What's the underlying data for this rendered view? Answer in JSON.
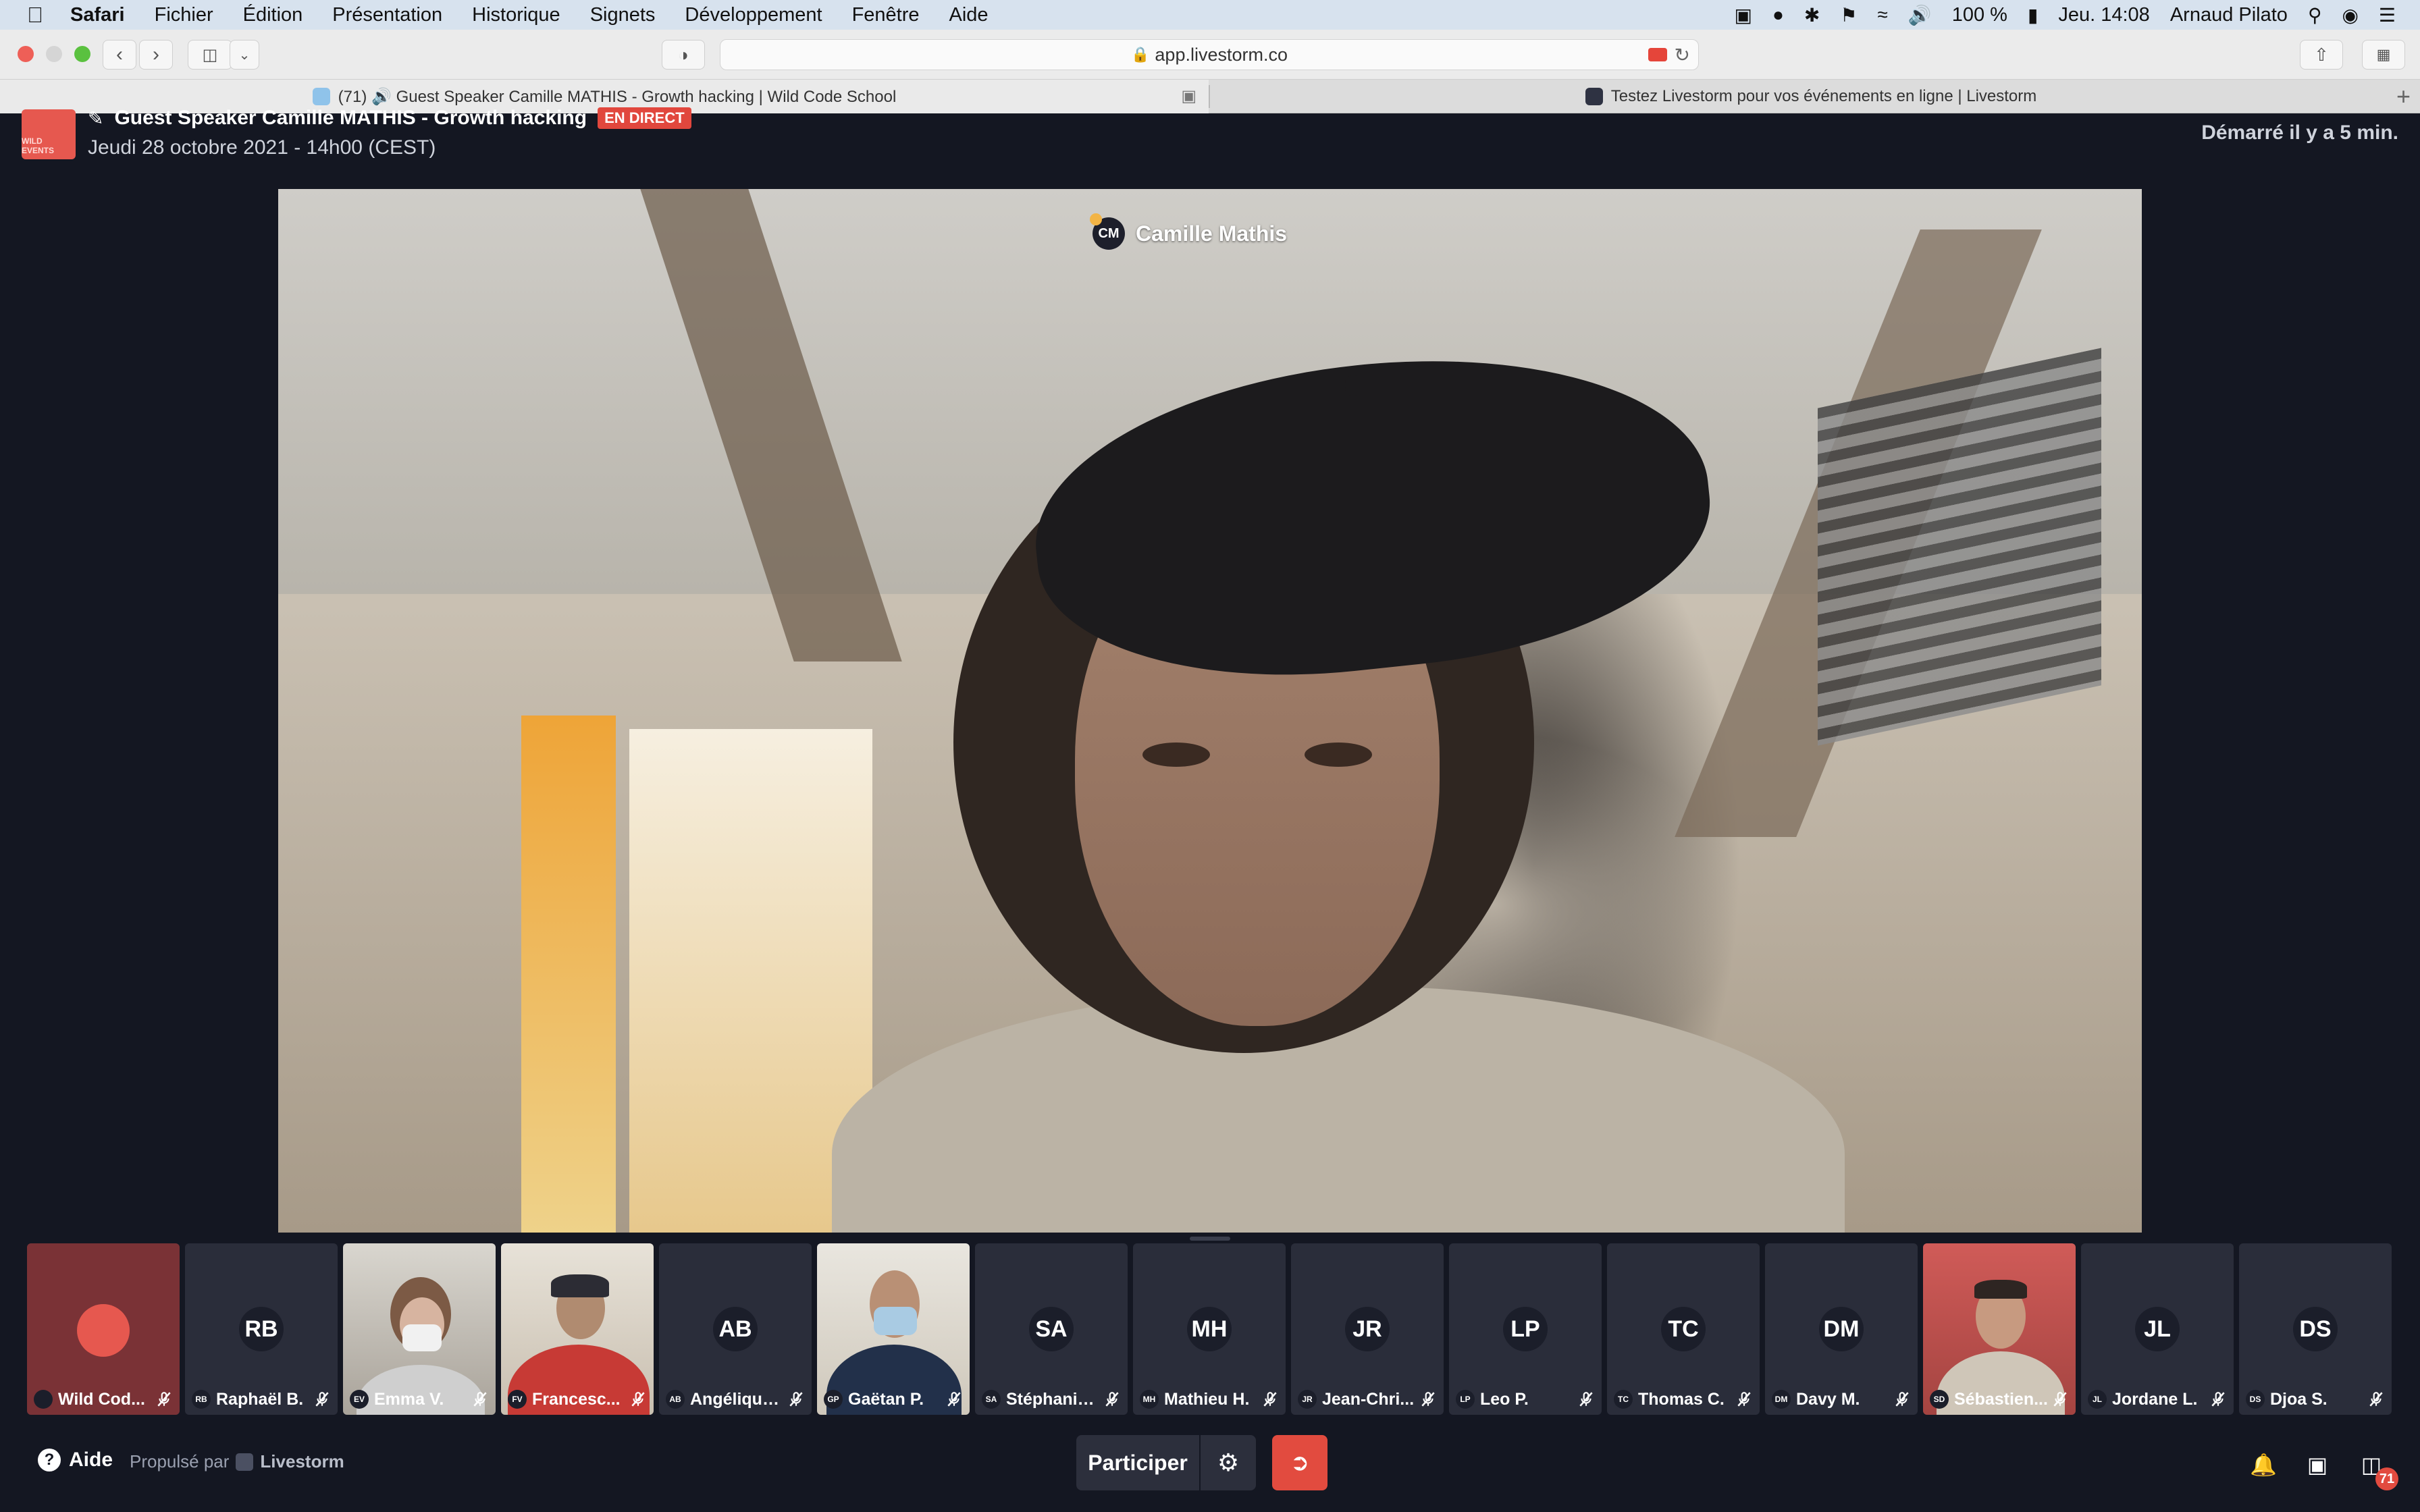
{
  "menubar": {
    "app": "Safari",
    "items": [
      "Fichier",
      "Édition",
      "Présentation",
      "Historique",
      "Signets",
      "Développement",
      "Fenêtre",
      "Aide"
    ],
    "battery": "100 %",
    "clock": "Jeu. 14:08",
    "user": "Arnaud Pilato"
  },
  "browser": {
    "url": "app.livestorm.co",
    "tabs": [
      {
        "label": "(71) 🔊 Guest Speaker Camille MATHIS - Growth hacking | Wild Code School",
        "active": true
      },
      {
        "label": "Testez Livestorm pour vos événements en ligne | Livestorm",
        "active": false
      }
    ]
  },
  "event": {
    "logo_text": "WILD EVENTS",
    "title": "Guest Speaker Camille MATHIS - Growth hacking",
    "live_label": "EN DIRECT",
    "date": "Jeudi 28 octobre 2021 - 14h00 (CEST)",
    "started": "Démarré il y a 5 min."
  },
  "speaker": {
    "initials": "CM",
    "name": "Camille Mathis"
  },
  "participants": [
    {
      "initials": "",
      "name": "Wild Cod...",
      "photo": "logo"
    },
    {
      "initials": "RB",
      "name": "Raphaël B.",
      "photo": ""
    },
    {
      "initials": "EV",
      "name": "Emma V.",
      "photo": "emma"
    },
    {
      "initials": "FV",
      "name": "Francesc...",
      "photo": "francesco"
    },
    {
      "initials": "AB",
      "name": "Angélique...",
      "photo": ""
    },
    {
      "initials": "GP",
      "name": "Gaëtan P.",
      "photo": "gaetan"
    },
    {
      "initials": "SA",
      "name": "Stéphanie...",
      "photo": ""
    },
    {
      "initials": "MH",
      "name": "Mathieu H.",
      "photo": ""
    },
    {
      "initials": "JR",
      "name": "Jean-Chri...",
      "photo": ""
    },
    {
      "initials": "LP",
      "name": "Leo P.",
      "photo": ""
    },
    {
      "initials": "TC",
      "name": "Thomas C.",
      "photo": ""
    },
    {
      "initials": "DM",
      "name": "Davy M.",
      "photo": ""
    },
    {
      "initials": "SD",
      "name": "Sébastien...",
      "photo": "sebastien"
    },
    {
      "initials": "JL",
      "name": "Jordane L.",
      "photo": ""
    },
    {
      "initials": "DS",
      "name": "Djoa S.",
      "photo": ""
    }
  ],
  "footer": {
    "help": "Aide",
    "powered_by": "Propulsé par",
    "brand": "Livestorm",
    "join": "Participer",
    "notification_count": "71"
  },
  "colors": {
    "background": "#141722",
    "tile": "#2a2d3a",
    "live_red": "#e1473d",
    "leave_red": "#e24b3f"
  }
}
